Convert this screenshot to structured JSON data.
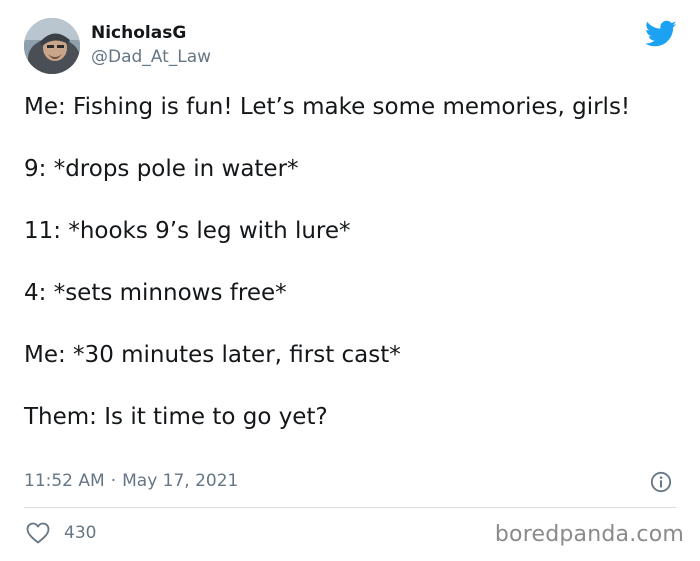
{
  "tweet": {
    "author_name": "NicholasG",
    "author_handle": "@Dad_At_Law",
    "paragraphs": [
      "Me: Fishing is fun! Let’s make some memories, girls!",
      "9: *drops pole in water*",
      "11: *hooks 9’s leg with lure*",
      "4: *sets minnows free*",
      "Me: *30 minutes later, first cast*",
      "Them: Is it time to go yet?"
    ],
    "time": "11:52 AM",
    "separator": "·",
    "date": "May 17, 2021",
    "likes": "430"
  },
  "watermark": "boredpanda.com",
  "icons": {
    "brand": "twitter-bird-icon",
    "info": "info-icon",
    "like": "heart-icon"
  },
  "colors": {
    "twitter_blue": "#1da1f2",
    "text_primary": "#14171a",
    "text_secondary": "#657786",
    "divider": "#d6dde3",
    "watermark": "#8a8a8a"
  }
}
